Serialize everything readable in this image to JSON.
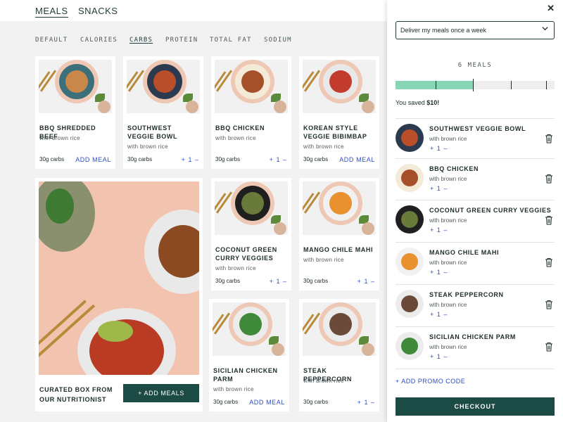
{
  "nav": {
    "items": [
      {
        "label": "MEALS",
        "active": true
      },
      {
        "label": "SNACKS",
        "active": false
      }
    ]
  },
  "sort_tabs": [
    {
      "label": "DEFAULT",
      "active": false
    },
    {
      "label": "CALORIES",
      "active": false
    },
    {
      "label": "CARBS",
      "active": true
    },
    {
      "label": "PROTEIN",
      "active": false
    },
    {
      "label": "TOTAL FAT",
      "active": false
    },
    {
      "label": "SODIUM",
      "active": false
    }
  ],
  "meals": [
    {
      "title": "BBQ SHREDDED BEEF",
      "subtitle": "with brown rice",
      "carbs": "30g carbs",
      "action": "ADD MEAL",
      "plate_color": "#3b6f7a",
      "food_color": "#c9874a"
    },
    {
      "title": "SOUTHWEST VEGGIE BOWL",
      "subtitle": "with brown rice",
      "carbs": "30g carbs",
      "stepper": {
        "plus": "+",
        "count": "1",
        "minus": "–"
      },
      "plate_color": "#2c3a4f",
      "food_color": "#b84f2a"
    },
    {
      "title": "BBQ CHICKEN",
      "subtitle": "with brown rice",
      "carbs": "30g carbs",
      "stepper": {
        "plus": "+",
        "count": "1",
        "minus": "–"
      },
      "plate_color": "#f3ead8",
      "food_color": "#a5502a"
    },
    {
      "title": "KOREAN STYLE VEGGIE BIBIMBAP",
      "subtitle": "with brown rice",
      "carbs": "30g carbs",
      "action": "ADD MEAL",
      "plate_color": "#e8e8e8",
      "food_color": "#c23b2c"
    },
    {
      "title": "COCONUT GREEN CURRY VEGGIES",
      "subtitle": "with brown rice",
      "carbs": "30g carbs",
      "stepper": {
        "plus": "+",
        "count": "1",
        "minus": "–"
      },
      "plate_color": "#1f1f1f",
      "food_color": "#6a7a3a"
    },
    {
      "title": "MANGO CHILE MAHI",
      "subtitle": "with brown rice",
      "carbs": "30g carbs",
      "stepper": {
        "plus": "+",
        "count": "1",
        "minus": "–"
      },
      "plate_color": "#f1f1f1",
      "food_color": "#e9902f"
    },
    {
      "title": "SICILIAN CHICKEN PARM",
      "subtitle": "with brown rice",
      "carbs": "30g carbs",
      "action": "ADD MEAL",
      "plate_color": "#ececec",
      "food_color": "#3e8a3a"
    },
    {
      "title": "STEAK PEPPERCORN",
      "subtitle": "with brown rice",
      "carbs": "30g carbs",
      "stepper": {
        "plus": "+",
        "count": "1",
        "minus": "–"
      },
      "plate_color": "#ececec",
      "food_color": "#6b4a3a"
    }
  ],
  "curated": {
    "title": "CURATED BOX FROM OUR NUTRITIONIST",
    "button": "+ ADD MEALS"
  },
  "panel": {
    "close_icon": "close-icon",
    "delivery_select": "Deliver my meals once a week",
    "meals_count": "6 MEALS",
    "progress": 0.49,
    "saved_prefix": "You saved ",
    "saved_amount": "$10!",
    "cart": [
      {
        "name": "SOUTHWEST VEGGIE BOWL",
        "subtitle": "with brown rice",
        "stepper": {
          "plus": "+",
          "count": "1",
          "minus": "–"
        },
        "plate_color": "#2c3a4f",
        "food_color": "#b84f2a"
      },
      {
        "name": "BBQ CHICKEN",
        "subtitle": "with brown rice",
        "stepper": {
          "plus": "+",
          "count": "1",
          "minus": "–"
        },
        "plate_color": "#f3ead8",
        "food_color": "#a5502a"
      },
      {
        "name": "COCONUT GREEN CURRY VEGGIES",
        "subtitle": "with brown rice",
        "stepper": {
          "plus": "+",
          "count": "1",
          "minus": "–"
        },
        "plate_color": "#1f1f1f",
        "food_color": "#6a7a3a"
      },
      {
        "name": "MANGO CHILE MAHI",
        "subtitle": "with brown rice",
        "stepper": {
          "plus": "+",
          "count": "1",
          "minus": "–"
        },
        "plate_color": "#f1f1f1",
        "food_color": "#e9902f"
      },
      {
        "name": "STEAK PEPPERCORN",
        "subtitle": "with brown rice",
        "stepper": {
          "plus": "+",
          "count": "1",
          "minus": "–"
        },
        "plate_color": "#ececec",
        "food_color": "#6b4a3a"
      },
      {
        "name": "SICILIAN CHICKEN PARM",
        "subtitle": "with brown rice",
        "stepper": {
          "plus": "+",
          "count": "1",
          "minus": "–"
        },
        "plate_color": "#ececec",
        "food_color": "#3e8a3a"
      }
    ],
    "promo": "+ ADD PROMO CODE",
    "checkout": "CHECKOUT"
  },
  "colors": {
    "brand_dark": "#1c4b46",
    "link_blue": "#2d4dc0",
    "progress_fill": "#86d5b4",
    "plate_ring": "#eec8b4"
  }
}
